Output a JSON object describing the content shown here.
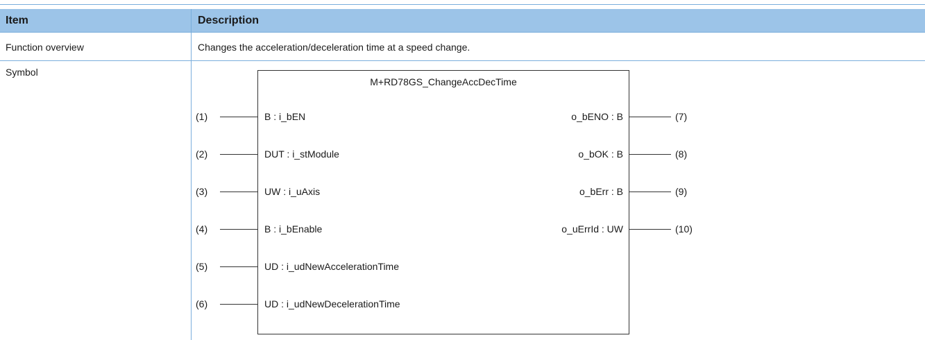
{
  "table": {
    "headers": {
      "item": "Item",
      "description": "Description"
    },
    "rows": [
      {
        "item": "Function overview",
        "description": "Changes the acceleration/deceleration time at a speed change."
      },
      {
        "item": "Symbol",
        "description": ""
      }
    ]
  },
  "symbol": {
    "name": "M+RD78GS_ChangeAccDecTime",
    "inputs": [
      {
        "num": "(1)",
        "label": "B : i_bEN"
      },
      {
        "num": "(2)",
        "label": "DUT : i_stModule"
      },
      {
        "num": "(3)",
        "label": "UW : i_uAxis"
      },
      {
        "num": "(4)",
        "label": "B : i_bEnable"
      },
      {
        "num": "(5)",
        "label": "UD : i_udNewAccelerationTime"
      },
      {
        "num": "(6)",
        "label": "UD : i_udNewDecelerationTime"
      }
    ],
    "outputs": [
      {
        "num": "(7)",
        "label": "o_bENO : B"
      },
      {
        "num": "(8)",
        "label": "o_bOK : B"
      },
      {
        "num": "(9)",
        "label": "o_bErr : B"
      },
      {
        "num": "(10)",
        "label": "o_uErrId : UW"
      }
    ]
  },
  "colors": {
    "header_bg": "#9cc4e8",
    "rule": "#7aaedc",
    "line": "#333333"
  }
}
